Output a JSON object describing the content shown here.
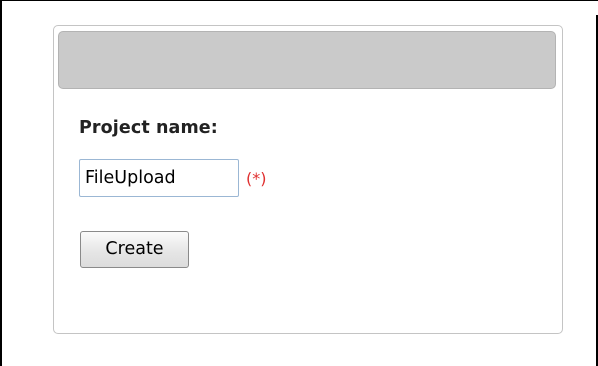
{
  "form": {
    "project_name_label": "Project name:",
    "project_name_value": "FileUpload",
    "required_indicator": "(*)",
    "create_label": "Create"
  },
  "colors": {
    "header_bar": "#cacaca",
    "required_indicator": "#e03030",
    "input_border": "#9bb7d4",
    "panel_border": "#c4c4c4"
  }
}
